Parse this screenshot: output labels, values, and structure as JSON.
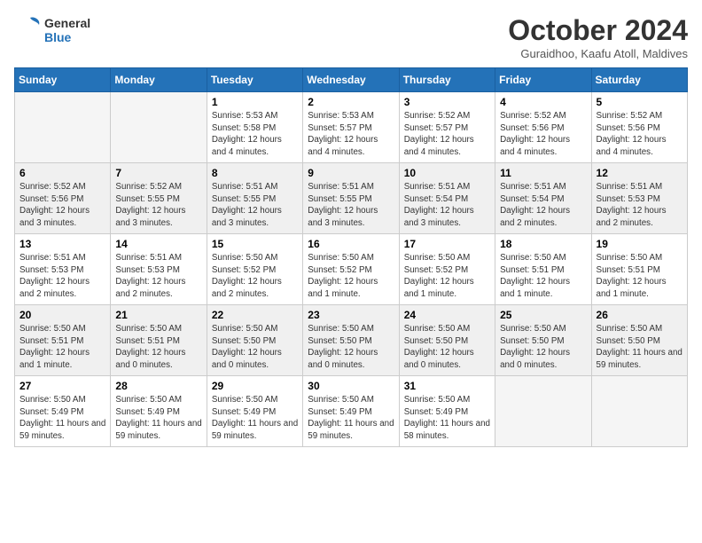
{
  "logo": {
    "text_general": "General",
    "text_blue": "Blue"
  },
  "header": {
    "month": "October 2024",
    "location": "Guraidhoo, Kaafu Atoll, Maldives"
  },
  "days_of_week": [
    "Sunday",
    "Monday",
    "Tuesday",
    "Wednesday",
    "Thursday",
    "Friday",
    "Saturday"
  ],
  "weeks": [
    {
      "shaded": false,
      "days": [
        {
          "num": "",
          "info": ""
        },
        {
          "num": "",
          "info": ""
        },
        {
          "num": "1",
          "info": "Sunrise: 5:53 AM\nSunset: 5:58 PM\nDaylight: 12 hours and 4 minutes."
        },
        {
          "num": "2",
          "info": "Sunrise: 5:53 AM\nSunset: 5:57 PM\nDaylight: 12 hours and 4 minutes."
        },
        {
          "num": "3",
          "info": "Sunrise: 5:52 AM\nSunset: 5:57 PM\nDaylight: 12 hours and 4 minutes."
        },
        {
          "num": "4",
          "info": "Sunrise: 5:52 AM\nSunset: 5:56 PM\nDaylight: 12 hours and 4 minutes."
        },
        {
          "num": "5",
          "info": "Sunrise: 5:52 AM\nSunset: 5:56 PM\nDaylight: 12 hours and 4 minutes."
        }
      ]
    },
    {
      "shaded": true,
      "days": [
        {
          "num": "6",
          "info": "Sunrise: 5:52 AM\nSunset: 5:56 PM\nDaylight: 12 hours and 3 minutes."
        },
        {
          "num": "7",
          "info": "Sunrise: 5:52 AM\nSunset: 5:55 PM\nDaylight: 12 hours and 3 minutes."
        },
        {
          "num": "8",
          "info": "Sunrise: 5:51 AM\nSunset: 5:55 PM\nDaylight: 12 hours and 3 minutes."
        },
        {
          "num": "9",
          "info": "Sunrise: 5:51 AM\nSunset: 5:55 PM\nDaylight: 12 hours and 3 minutes."
        },
        {
          "num": "10",
          "info": "Sunrise: 5:51 AM\nSunset: 5:54 PM\nDaylight: 12 hours and 3 minutes."
        },
        {
          "num": "11",
          "info": "Sunrise: 5:51 AM\nSunset: 5:54 PM\nDaylight: 12 hours and 2 minutes."
        },
        {
          "num": "12",
          "info": "Sunrise: 5:51 AM\nSunset: 5:53 PM\nDaylight: 12 hours and 2 minutes."
        }
      ]
    },
    {
      "shaded": false,
      "days": [
        {
          "num": "13",
          "info": "Sunrise: 5:51 AM\nSunset: 5:53 PM\nDaylight: 12 hours and 2 minutes."
        },
        {
          "num": "14",
          "info": "Sunrise: 5:51 AM\nSunset: 5:53 PM\nDaylight: 12 hours and 2 minutes."
        },
        {
          "num": "15",
          "info": "Sunrise: 5:50 AM\nSunset: 5:52 PM\nDaylight: 12 hours and 2 minutes."
        },
        {
          "num": "16",
          "info": "Sunrise: 5:50 AM\nSunset: 5:52 PM\nDaylight: 12 hours and 1 minute."
        },
        {
          "num": "17",
          "info": "Sunrise: 5:50 AM\nSunset: 5:52 PM\nDaylight: 12 hours and 1 minute."
        },
        {
          "num": "18",
          "info": "Sunrise: 5:50 AM\nSunset: 5:51 PM\nDaylight: 12 hours and 1 minute."
        },
        {
          "num": "19",
          "info": "Sunrise: 5:50 AM\nSunset: 5:51 PM\nDaylight: 12 hours and 1 minute."
        }
      ]
    },
    {
      "shaded": true,
      "days": [
        {
          "num": "20",
          "info": "Sunrise: 5:50 AM\nSunset: 5:51 PM\nDaylight: 12 hours and 1 minute."
        },
        {
          "num": "21",
          "info": "Sunrise: 5:50 AM\nSunset: 5:51 PM\nDaylight: 12 hours and 0 minutes."
        },
        {
          "num": "22",
          "info": "Sunrise: 5:50 AM\nSunset: 5:50 PM\nDaylight: 12 hours and 0 minutes."
        },
        {
          "num": "23",
          "info": "Sunrise: 5:50 AM\nSunset: 5:50 PM\nDaylight: 12 hours and 0 minutes."
        },
        {
          "num": "24",
          "info": "Sunrise: 5:50 AM\nSunset: 5:50 PM\nDaylight: 12 hours and 0 minutes."
        },
        {
          "num": "25",
          "info": "Sunrise: 5:50 AM\nSunset: 5:50 PM\nDaylight: 12 hours and 0 minutes."
        },
        {
          "num": "26",
          "info": "Sunrise: 5:50 AM\nSunset: 5:50 PM\nDaylight: 11 hours and 59 minutes."
        }
      ]
    },
    {
      "shaded": false,
      "days": [
        {
          "num": "27",
          "info": "Sunrise: 5:50 AM\nSunset: 5:49 PM\nDaylight: 11 hours and 59 minutes."
        },
        {
          "num": "28",
          "info": "Sunrise: 5:50 AM\nSunset: 5:49 PM\nDaylight: 11 hours and 59 minutes."
        },
        {
          "num": "29",
          "info": "Sunrise: 5:50 AM\nSunset: 5:49 PM\nDaylight: 11 hours and 59 minutes."
        },
        {
          "num": "30",
          "info": "Sunrise: 5:50 AM\nSunset: 5:49 PM\nDaylight: 11 hours and 59 minutes."
        },
        {
          "num": "31",
          "info": "Sunrise: 5:50 AM\nSunset: 5:49 PM\nDaylight: 11 hours and 58 minutes."
        },
        {
          "num": "",
          "info": ""
        },
        {
          "num": "",
          "info": ""
        }
      ]
    }
  ]
}
